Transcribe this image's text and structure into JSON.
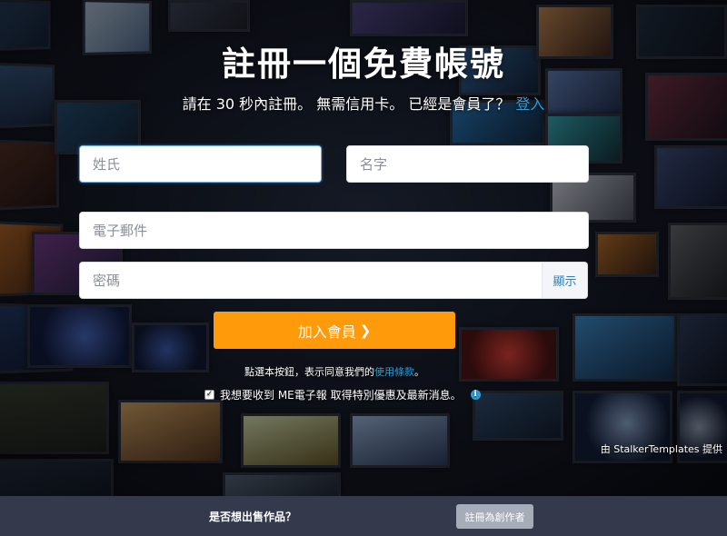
{
  "form": {
    "title": "註冊一個免費帳號",
    "subtitle_prefix": "請在 30 秒內註冊。 無需信用卡。 已經是會員了？",
    "login_link": "登入",
    "last_name_placeholder": "姓氏",
    "first_name_placeholder": "名字",
    "email_placeholder": "電子郵件",
    "password_placeholder": "密碼",
    "show_password_label": "顯示",
    "join_button_label": "加入會員",
    "terms_prefix": "點選本按鈕，表示同意我們的",
    "terms_link": "使用條款",
    "terms_suffix": "。",
    "optin_label": "我想要收到 ME電子報 取得特別優惠及最新消息。",
    "optin_checked": true
  },
  "credit": "由 StalkerTemplates 提供",
  "footer": {
    "question": "是否想出售作品？",
    "creator_button_label": "註冊為創作者"
  },
  "colors": {
    "accent_orange": "#ff9a0a",
    "link_blue": "#2f9ed8",
    "footer_bg": "#343a4b",
    "footer_button_bg": "#a7adb8"
  },
  "icons": {
    "join_button_chevron": "chevron-right-icon",
    "optin_info": "info-icon",
    "optin_checkbox": "checkmark-icon"
  }
}
